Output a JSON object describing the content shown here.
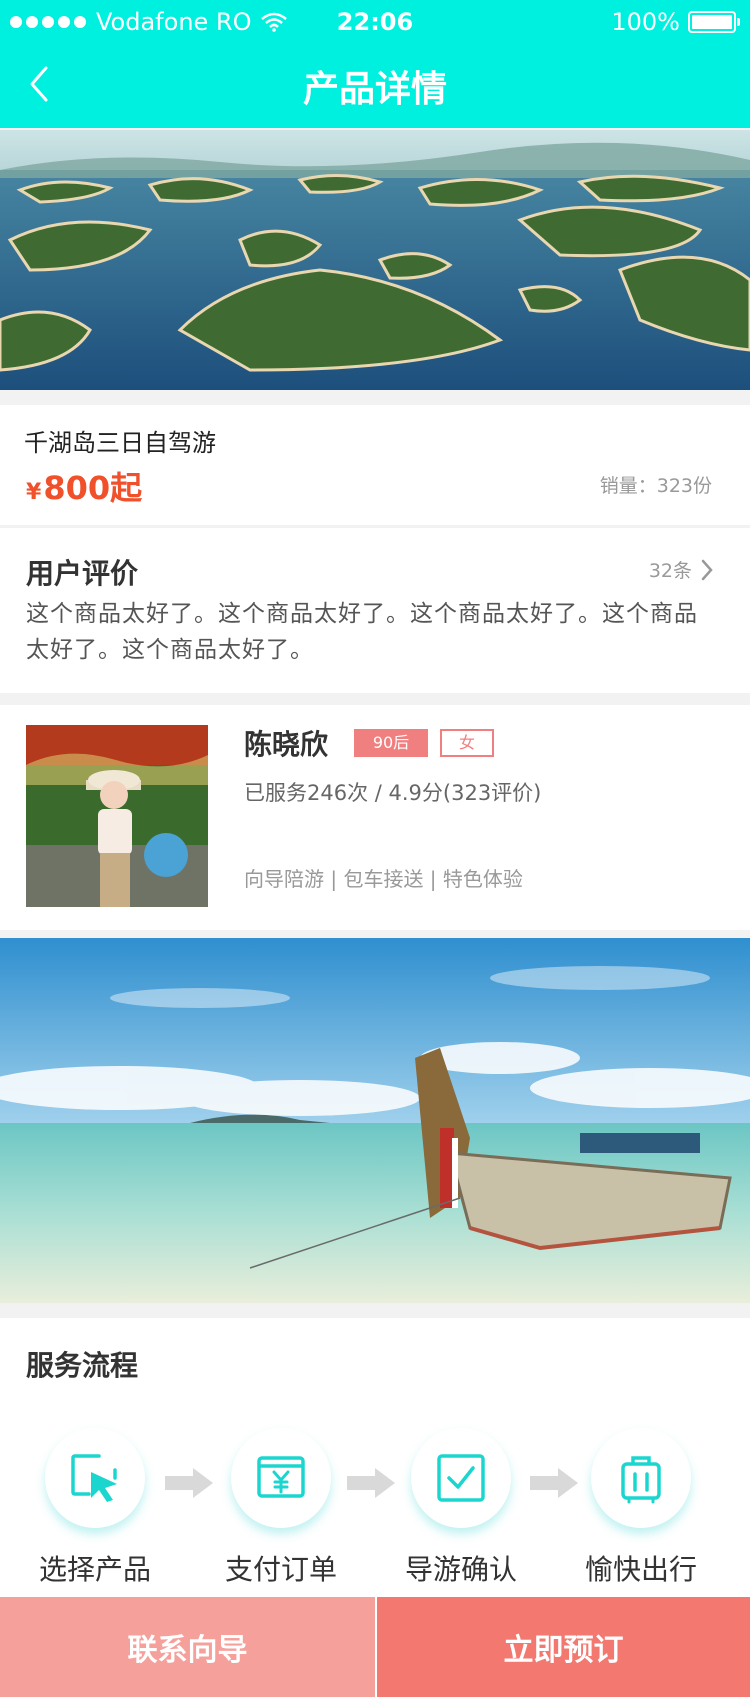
{
  "status_bar": {
    "carrier": "Vodafone RO",
    "time": "22:06",
    "battery": "100%"
  },
  "header": {
    "title": "产品详情",
    "back_icon": "chevron-left-icon"
  },
  "product": {
    "name": "千湖岛三日自驾游",
    "price_symbol": "¥",
    "price": "800起",
    "sales": "销量：323份"
  },
  "reviews": {
    "title": "用户评价",
    "count": "32条",
    "text": "这个商品太好了。这个商品太好了。这个商品太好了。这个商品太好了。这个商品太好了。"
  },
  "guide": {
    "name": "陈晓欣",
    "tag_age": "90后",
    "tag_gender": "女",
    "stats": "已服务246次 / 4.9分(323评价)",
    "services": "向导陪游 | 包车接送 | 特色体验"
  },
  "process": {
    "title": "服务流程",
    "steps": [
      {
        "label": "选择产品",
        "icon": "cursor-icon"
      },
      {
        "label": "支付订单",
        "icon": "payment-icon"
      },
      {
        "label": "导游确认",
        "icon": "check-icon"
      },
      {
        "label": "愉快出行",
        "icon": "luggage-icon"
      }
    ]
  },
  "actions": {
    "contact": "联系向导",
    "book": "立即预订"
  },
  "colors": {
    "primary": "#00f0e0",
    "price": "#f0502a",
    "accent_pink": "#f08080",
    "button_left": "#f5a09a",
    "button_right": "#f27870"
  }
}
